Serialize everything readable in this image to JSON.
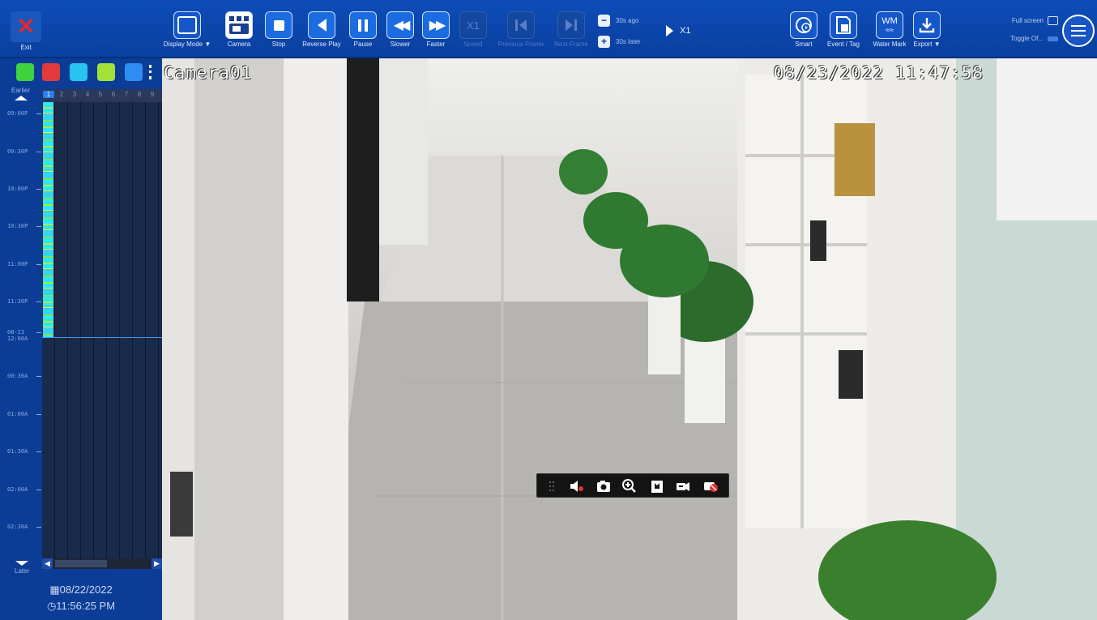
{
  "toolbar": {
    "exit_label": "Exit",
    "buttons": [
      {
        "label": "Display Mode ▼",
        "icon": "display-mode-icon",
        "enabled": true
      },
      {
        "label": "Camera",
        "icon": "camera-grid-icon",
        "enabled": true
      },
      {
        "label": "Stop",
        "icon": "stop-icon",
        "enabled": true
      },
      {
        "label": "Reverse Play",
        "icon": "reverse-play-icon",
        "enabled": true
      },
      {
        "label": "Pause",
        "icon": "pause-icon",
        "enabled": true
      },
      {
        "label": "Slower",
        "icon": "slower-icon",
        "enabled": true
      },
      {
        "label": "Faster",
        "icon": "faster-icon",
        "enabled": true
      },
      {
        "label": "Speed",
        "icon_text": "X1",
        "enabled": false
      },
      {
        "label": "Previous Frame",
        "icon": "previous-frame-icon",
        "enabled": false
      },
      {
        "label": "Next Frame",
        "icon": "next-frame-icon",
        "enabled": false
      }
    ],
    "seek_back_label": "30s ago",
    "seek_forward_label": "30s later",
    "speed_indicator": "X1",
    "right_buttons": [
      {
        "label": "Smart",
        "icon": "smart-icon"
      },
      {
        "label": "Event / Tag",
        "icon": "event-tag-icon"
      },
      {
        "label": "Water Mark",
        "icon_text": "WM",
        "icon": "watermark-icon"
      },
      {
        "label": "Export ▼",
        "icon": "export-icon"
      }
    ],
    "full_screen_label": "Full screen",
    "toggle_label": "Toggle Of..."
  },
  "left_panel": {
    "earlier_label": "Earlier",
    "later_label": "Later",
    "time_labels": [
      "09:00P",
      "09:30P",
      "10:00P",
      "10:30P",
      "11:00P",
      "11:30P",
      "08-23 12:00A",
      "00:30A",
      "01:00A",
      "01:30A",
      "02:00A",
      "02:30A"
    ],
    "channels": [
      "1",
      "2",
      "3",
      "4",
      "5",
      "6",
      "7",
      "8",
      "9"
    ],
    "selected_channel": "1",
    "date": "08/22/2022",
    "time": "11:56:25 PM",
    "filter_colors": [
      "#3fd23f",
      "#e23a3a",
      "#27c4ef",
      "#a3e03a",
      "#2f8cf0"
    ]
  },
  "camera": {
    "name": "Camera01",
    "timestamp": "08/23/2022  11:47:58",
    "mini_toolbar_icons": [
      "drag-handle-icon",
      "mute-icon",
      "snapshot-icon",
      "zoom-in-icon",
      "bookmark-icon",
      "clip-icon",
      "stop-record-icon"
    ]
  },
  "colors": {
    "toolbar_bg": "#0d4db9",
    "panel_bg": "#0c3d96",
    "accent": "#2b7cf0",
    "record_cyan": "#2de6ff",
    "record_green": "#a8ee3a"
  }
}
